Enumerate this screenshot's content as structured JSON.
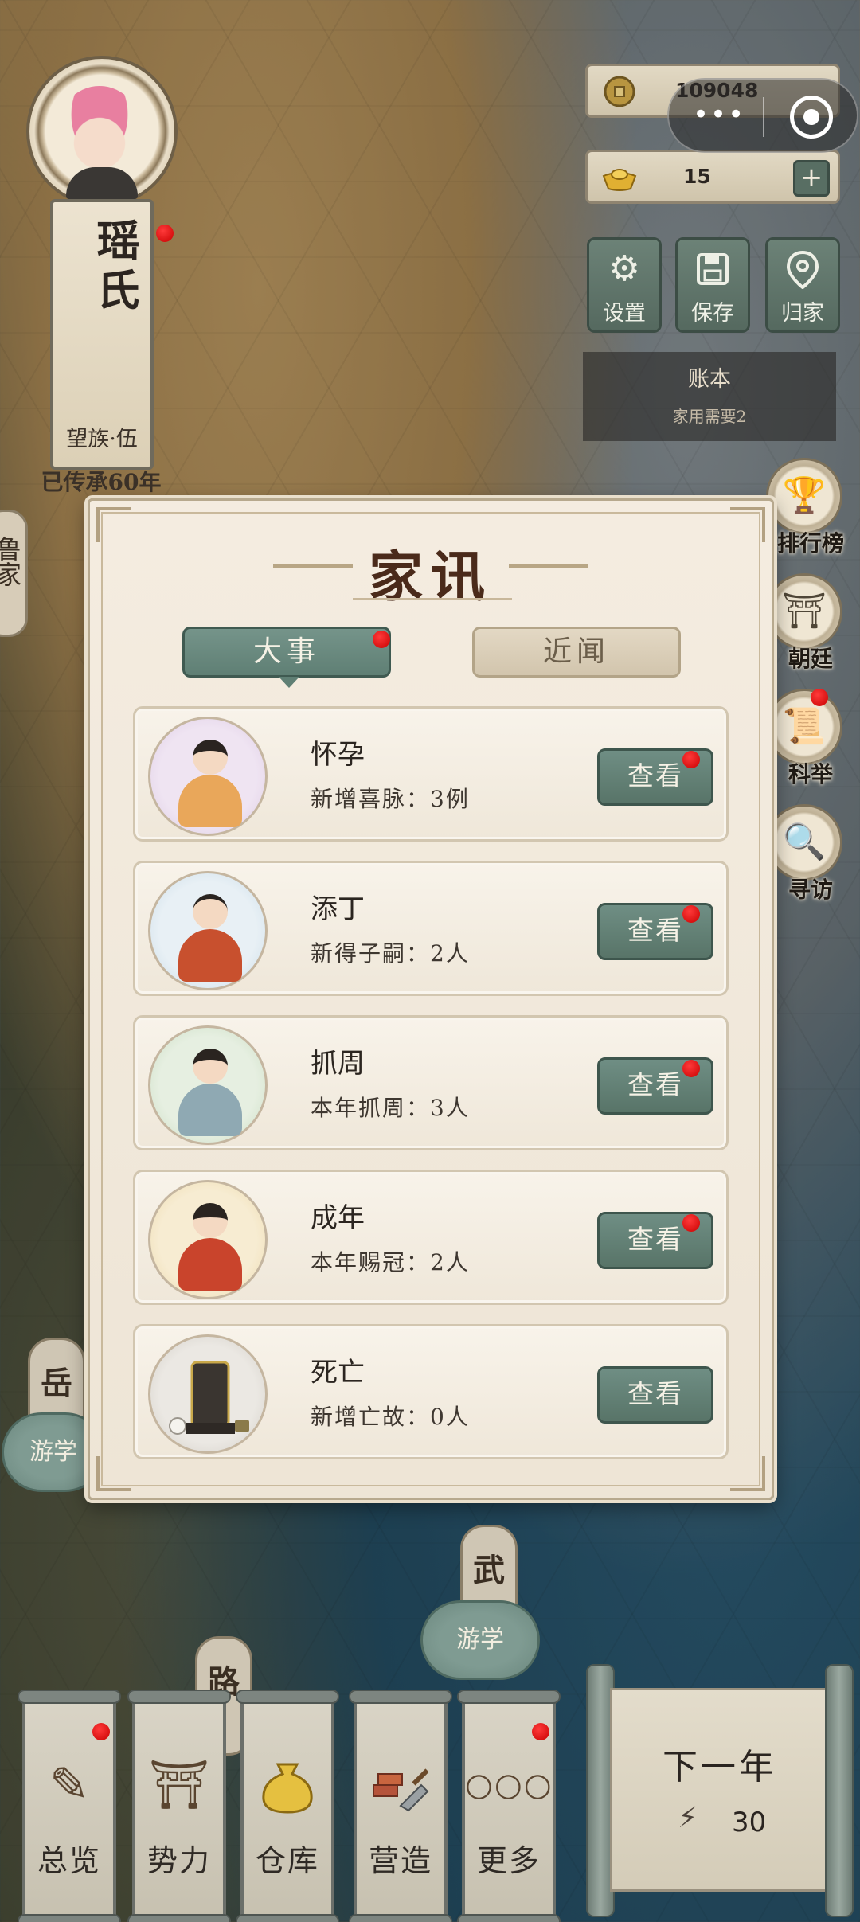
{
  "ancestor": {
    "name": "瑶氏",
    "rank": "望族·伍",
    "years": "已传承60年"
  },
  "resources": [
    {
      "icon": "copper-coin-icon",
      "value": "109048"
    },
    {
      "icon": "gold-ingot-icon",
      "value": "15"
    }
  ],
  "capsule": {
    "more": "•••"
  },
  "toolbar": [
    {
      "icon": "gear-icon",
      "label": "设置"
    },
    {
      "icon": "save-icon",
      "label": "保存"
    },
    {
      "icon": "location-pin-icon",
      "label": "归家"
    }
  ],
  "ledger": {
    "title": "账本",
    "sub": "家用需要2"
  },
  "side_menu": [
    {
      "icon": "trophy-icon",
      "label": "排行榜"
    },
    {
      "icon": "palace-icon",
      "label": "朝廷"
    },
    {
      "icon": "exam-scroll-icon",
      "label": "科举"
    },
    {
      "icon": "magnifier-icon",
      "label": "寻访"
    }
  ],
  "map": {
    "left_tag": "鲁家",
    "labels": [
      "岳",
      "武",
      "路"
    ],
    "travel_tags": [
      "游学",
      "游学"
    ]
  },
  "dialog": {
    "title": "家讯",
    "tabs": [
      "大事",
      "近闻"
    ],
    "rows": [
      {
        "title": "怀孕",
        "sub": "新增喜脉：3例",
        "btn": "查看",
        "color": "#e3d6ea",
        "dot": true
      },
      {
        "title": "添丁",
        "sub": "新得子嗣：2人",
        "btn": "查看",
        "color": "#d9e6ef",
        "dot": true
      },
      {
        "title": "抓周",
        "sub": "本年抓周：3人",
        "btn": "查看",
        "color": "#dfecd9",
        "dot": true
      },
      {
        "title": "成年",
        "sub": "本年赐冠：2人",
        "btn": "查看",
        "color": "#f4e7c8",
        "dot": true
      },
      {
        "title": "死亡",
        "sub": "新增亡故：0人",
        "btn": "查看",
        "color": "#dedbd6",
        "dot": false
      }
    ]
  },
  "bottom_nav": [
    {
      "icon": "scroll-brush-icon",
      "label": "总览"
    },
    {
      "icon": "pavilion-icon",
      "label": "势力"
    },
    {
      "icon": "money-bag-icon",
      "label": "仓库"
    },
    {
      "icon": "trowel-bricks-icon",
      "label": "营造"
    },
    {
      "icon": "more-dots-icon",
      "label": "更多"
    }
  ],
  "next_year": {
    "label": "下一年",
    "cost": "30"
  }
}
